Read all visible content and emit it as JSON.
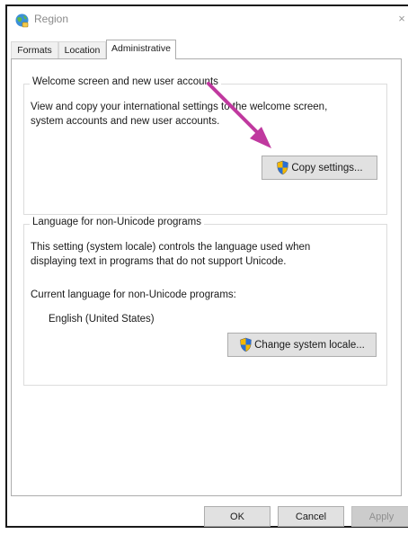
{
  "window": {
    "title": "Region",
    "close_glyph": "×"
  },
  "tabs": [
    {
      "label": "Formats",
      "active": false
    },
    {
      "label": "Location",
      "active": false
    },
    {
      "label": "Administrative",
      "active": true
    }
  ],
  "welcome_group": {
    "legend": "Welcome screen and new user accounts",
    "description_line1": "View and copy your international settings to the welcome screen,",
    "description_line2": "system accounts and new user accounts.",
    "button_label": "Copy settings...",
    "button_icon": "uac-shield-icon"
  },
  "locale_group": {
    "legend": "Language for non-Unicode programs",
    "description_line1": "This setting (system locale) controls the language used when",
    "description_line2": "displaying text in programs that do not support Unicode.",
    "current_label": "Current language for non-Unicode programs:",
    "current_value": "English (United States)",
    "button_label": "Change system locale...",
    "button_icon": "uac-shield-icon"
  },
  "footer": {
    "ok_label": "OK",
    "cancel_label": "Cancel",
    "apply_label": "Apply"
  },
  "colors": {
    "annotation_arrow": "#c0399f",
    "shield_blue": "#2a6fd6",
    "shield_yellow": "#f5b800"
  }
}
